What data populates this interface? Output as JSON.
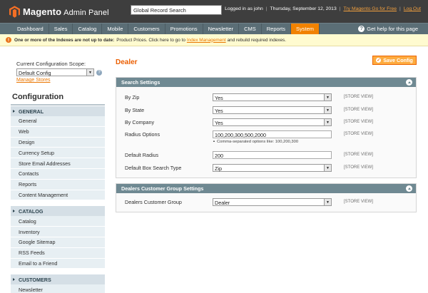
{
  "header": {
    "logo_brand": "Magento",
    "logo_suffix": "Admin Panel",
    "search_value": "Global Record Search",
    "logged_in": "Logged in as john",
    "date": "Thursday, September 12, 2013",
    "try_link": "Try Magento Go for Free",
    "logout": "Log Out"
  },
  "nav": {
    "items": [
      "Dashboard",
      "Sales",
      "Catalog",
      "Mobile",
      "Customers",
      "Promotions",
      "Newsletter",
      "CMS",
      "Reports",
      "System"
    ],
    "active": "System",
    "help": "Get help for this page"
  },
  "notice": {
    "bold": "One or more of the Indexes are not up to date:",
    "text1": "Product Prices. Click here to go to",
    "link": "Index Management",
    "text2": "and rebuild required indexes."
  },
  "sidebar": {
    "scope_label": "Current Configuration Scope:",
    "scope_value": "Default Config",
    "manage_stores": "Manage Stores",
    "title": "Configuration",
    "sections": [
      {
        "label": "GENERAL",
        "items": [
          "General",
          "Web",
          "Design",
          "Currency Setup",
          "Store Email Addresses",
          "Contacts",
          "Reports",
          "Content Management"
        ]
      },
      {
        "label": "CATALOG",
        "items": [
          "Catalog",
          "Inventory",
          "Google Sitemap",
          "RSS Feeds",
          "Email to a Friend"
        ]
      },
      {
        "label": "CUSTOMERS",
        "items": [
          "Newsletter"
        ]
      }
    ]
  },
  "main": {
    "title": "Dealer",
    "save_label": "Save Config",
    "fieldsets": [
      {
        "title": "Search Settings",
        "rows": [
          {
            "label": "By Zip",
            "type": "select",
            "value": "Yes",
            "scope": "[STORE VIEW]"
          },
          {
            "label": "By State",
            "type": "select",
            "value": "Yes",
            "scope": "[STORE VIEW]"
          },
          {
            "label": "By Company",
            "type": "select",
            "value": "Yes",
            "scope": "[STORE VIEW]"
          },
          {
            "label": "Radius Options",
            "type": "input",
            "value": "100,200,300,500,2000",
            "scope": "[STORE VIEW]",
            "hint": "Comma-separated options like: 100,200,300"
          },
          {
            "label": "Default Radius",
            "type": "input",
            "value": "200",
            "scope": "[STORE VIEW]"
          },
          {
            "label": "Default Box Search Type",
            "type": "select",
            "value": "Zip",
            "scope": "[STORE VIEW]"
          }
        ]
      },
      {
        "title": "Dealers Customer Group Settings",
        "rows": [
          {
            "label": "Dealers Customer Group",
            "type": "select",
            "value": "Dealer",
            "scope": "[STORE VIEW]"
          }
        ]
      }
    ]
  },
  "colors": {
    "accent": "#f18200",
    "header": "#3e3e3e",
    "nav": "#5b6e76",
    "fieldset_head": "#6f8992",
    "title": "#eb5e00"
  }
}
